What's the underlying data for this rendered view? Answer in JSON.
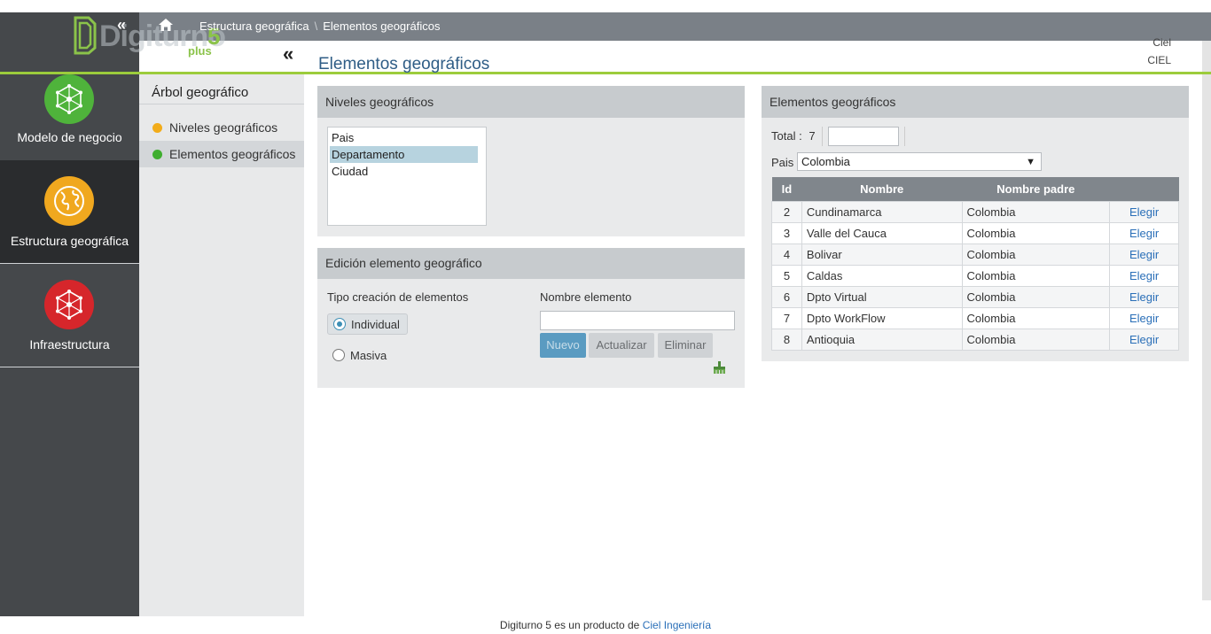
{
  "header": {
    "breadcrumb": [
      "Estructura geográfica",
      "Elementos geográficos"
    ],
    "logo": {
      "word": "Digiturno",
      "five": "5",
      "plus": "plus"
    },
    "user": {
      "name": "Ciel",
      "org": "CIEL"
    }
  },
  "nav": {
    "items": [
      {
        "label": "Modelo de negocio",
        "icon": "network-icon",
        "color": "#4fb33b"
      },
      {
        "label": "Estructura geográfica",
        "icon": "globe-icon",
        "color": "#f0a81f"
      },
      {
        "label": "Infraestructura",
        "icon": "network-icon",
        "color": "#d6262b"
      }
    ]
  },
  "tree": {
    "title": "Árbol geográfico",
    "items": [
      {
        "label": "Niveles geográficos",
        "dot": "#f2ac1a"
      },
      {
        "label": "Elementos geográficos",
        "dot": "#3fae2f"
      }
    ]
  },
  "page_title": "Elementos geográficos",
  "levels_panel": {
    "title": "Niveles geográficos",
    "items": [
      "Pais",
      "Departamento",
      "Ciudad"
    ],
    "selected": "Departamento"
  },
  "edit_panel": {
    "title": "Edición elemento geográfico",
    "type_label": "Tipo creación de elementos",
    "option_individual": "Individual",
    "option_masiva": "Masiva",
    "name_label": "Nombre elemento",
    "name_value": "",
    "btn_new": "Nuevo",
    "btn_update": "Actualizar",
    "btn_delete": "Eliminar"
  },
  "elements_panel": {
    "title": "Elementos geográficos",
    "total_label": "Total :",
    "total_value": "7",
    "filter_value": "",
    "country_label": "Pais",
    "country_selected": "Colombia",
    "columns": [
      "Id",
      "Nombre",
      "Nombre padre",
      ""
    ],
    "rows": [
      {
        "id": "2",
        "name": "Cundinamarca",
        "parent": "Colombia",
        "action": "Elegir"
      },
      {
        "id": "3",
        "name": "Valle del Cauca",
        "parent": "Colombia",
        "action": "Elegir"
      },
      {
        "id": "4",
        "name": "Bolivar",
        "parent": "Colombia",
        "action": "Elegir"
      },
      {
        "id": "5",
        "name": "Caldas",
        "parent": "Colombia",
        "action": "Elegir"
      },
      {
        "id": "6",
        "name": "Dpto Virtual",
        "parent": "Colombia",
        "action": "Elegir"
      },
      {
        "id": "7",
        "name": "Dpto WorkFlow",
        "parent": "Colombia",
        "action": "Elegir"
      },
      {
        "id": "8",
        "name": "Antioquia",
        "parent": "Colombia",
        "action": "Elegir"
      }
    ]
  },
  "footer": {
    "text": "Digiturno 5 es un producto de",
    "link": "Ciel Ingeniería"
  }
}
